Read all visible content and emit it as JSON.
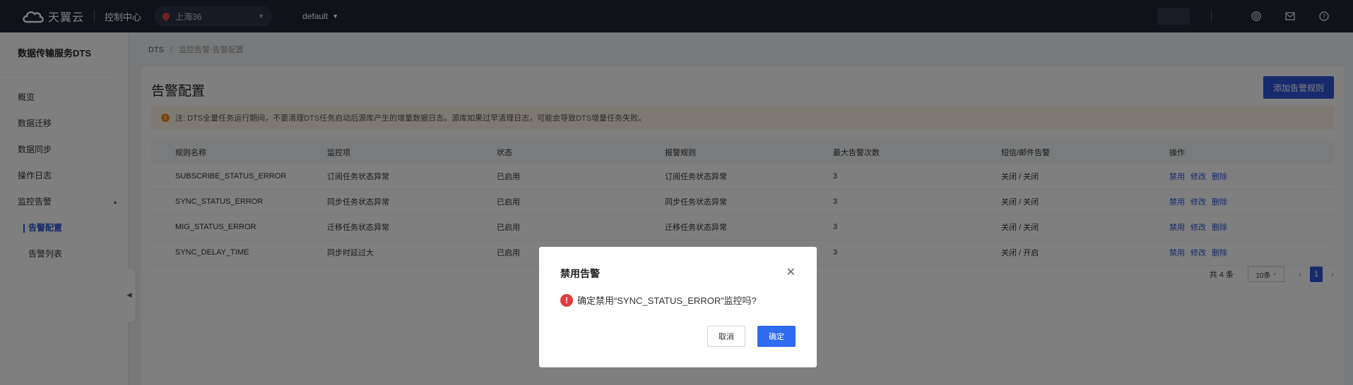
{
  "topbar": {
    "brand": "天翼云",
    "console": "控制中心",
    "region": "上海36",
    "project": "default",
    "icons": [
      "target-icon",
      "mail-icon",
      "help-icon"
    ]
  },
  "sidebar": {
    "title": "数据传输服务DTS",
    "items": [
      {
        "label": "概览"
      },
      {
        "label": "数据迁移"
      },
      {
        "label": "数据同步"
      },
      {
        "label": "操作日志"
      },
      {
        "label": "监控告警"
      }
    ],
    "subitems": [
      {
        "label": "告警配置",
        "active": true
      },
      {
        "label": "告警列表",
        "active": false
      }
    ]
  },
  "breadcrumb": {
    "root": "DTS",
    "sep": "/",
    "current": "监控告警-告警配置"
  },
  "main": {
    "title": "告警配置",
    "add_button": "添加告警规则",
    "notice": "注: DTS全量任务运行期间，不要清理DTS任务启动后源库产生的增量数据日志。源库如果过早清理日志，可能会导致DTS增量任务失败。"
  },
  "table": {
    "headers": [
      "规则名称",
      "监控项",
      "状态",
      "报警规则",
      "最大告警次数",
      "短信/邮件告警",
      "操作"
    ],
    "rows": [
      {
        "name": "SUBSCRIBE_STATUS_ERROR",
        "item": "订阅任务状态异常",
        "status": "已启用",
        "rule": "订阅任务状态异常",
        "max": "3",
        "notify": "关闭 / 关闭"
      },
      {
        "name": "SYNC_STATUS_ERROR",
        "item": "同步任务状态异常",
        "status": "已启用",
        "rule": "同步任务状态异常",
        "max": "3",
        "notify": "关闭 / 关闭"
      },
      {
        "name": "MIG_STATUS_ERROR",
        "item": "迁移任务状态异常",
        "status": "已启用",
        "rule": "迁移任务状态异常",
        "max": "3",
        "notify": "关闭 / 关闭"
      },
      {
        "name": "SYNC_DELAY_TIME",
        "item": "同步时延过大",
        "status": "已启用",
        "rule": "",
        "max": "3",
        "notify": "关闭 / 开启"
      }
    ],
    "actions": [
      "禁用",
      "修改",
      "删除"
    ]
  },
  "pager": {
    "total": "共 4 条",
    "page_size": "10条",
    "current_page": "1"
  },
  "modal": {
    "title": "禁用告警",
    "message": "确定禁用“SYNC_STATUS_ERROR”监控吗?",
    "cancel": "取消",
    "confirm": "确定"
  }
}
